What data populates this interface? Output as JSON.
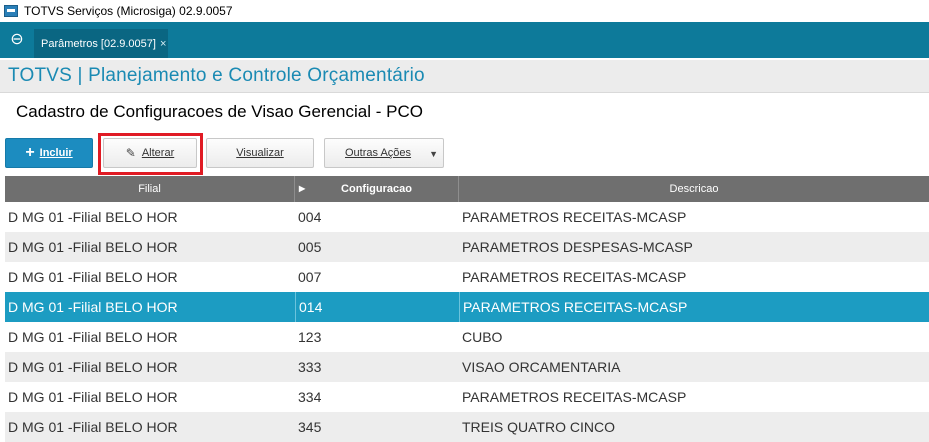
{
  "window": {
    "title": "TOTVS Serviços (Microsiga) 02.9.0057"
  },
  "tabbar": {
    "logo_icon": "totvs-logo-icon",
    "tab_label": "Parâmetros [02.9.0057]",
    "tab_close": "×"
  },
  "module": {
    "title": "TOTVS | Planejamento e Controle Orçamentário"
  },
  "routine": {
    "title": "Cadastro de Configuracoes de Visao Gerencial - PCO"
  },
  "toolbar": {
    "incluir_icon": "+",
    "incluir_label": "Incluir",
    "alterar_icon": "✎",
    "alterar_label": "Alterar",
    "visualizar_label": "Visualizar",
    "outras_label": "Outras Ações",
    "outras_caret": "▼"
  },
  "grid": {
    "headers": {
      "filial": "Filial",
      "configuracao": "Configuracao",
      "descricao": "Descricao",
      "sort_icon": "▶"
    },
    "rows": [
      {
        "filial": "D MG 01 -Filial BELO HOR",
        "configuracao": "004",
        "descricao": "PARAMETROS RECEITAS-MCASP"
      },
      {
        "filial": "D MG 01 -Filial BELO HOR",
        "configuracao": "005",
        "descricao": "PARAMETROS DESPESAS-MCASP"
      },
      {
        "filial": "D MG 01 -Filial BELO HOR",
        "configuracao": "007",
        "descricao": "PARAMETROS RECEITAS-MCASP"
      },
      {
        "filial": "D MG 01 -Filial BELO HOR",
        "configuracao": "014",
        "descricao": "PARAMETROS RECEITAS-MCASP"
      },
      {
        "filial": "D MG 01 -Filial BELO HOR",
        "configuracao": "123",
        "descricao": "CUBO"
      },
      {
        "filial": "D MG 01 -Filial BELO HOR",
        "configuracao": "333",
        "descricao": "VISAO ORCAMENTARIA"
      },
      {
        "filial": "D MG 01 -Filial BELO HOR",
        "configuracao": "334",
        "descricao": "PARAMETROS RECEITAS-MCASP"
      },
      {
        "filial": "D MG 01 -Filial BELO HOR",
        "configuracao": "345",
        "descricao": "TREIS QUATRO CINCO"
      }
    ],
    "selected_index": 3
  },
  "colors": {
    "accent": "#0d7a9a",
    "selected_row": "#1c9cc2",
    "highlight_box": "#e01b24",
    "module_title": "#1a8ab3"
  }
}
